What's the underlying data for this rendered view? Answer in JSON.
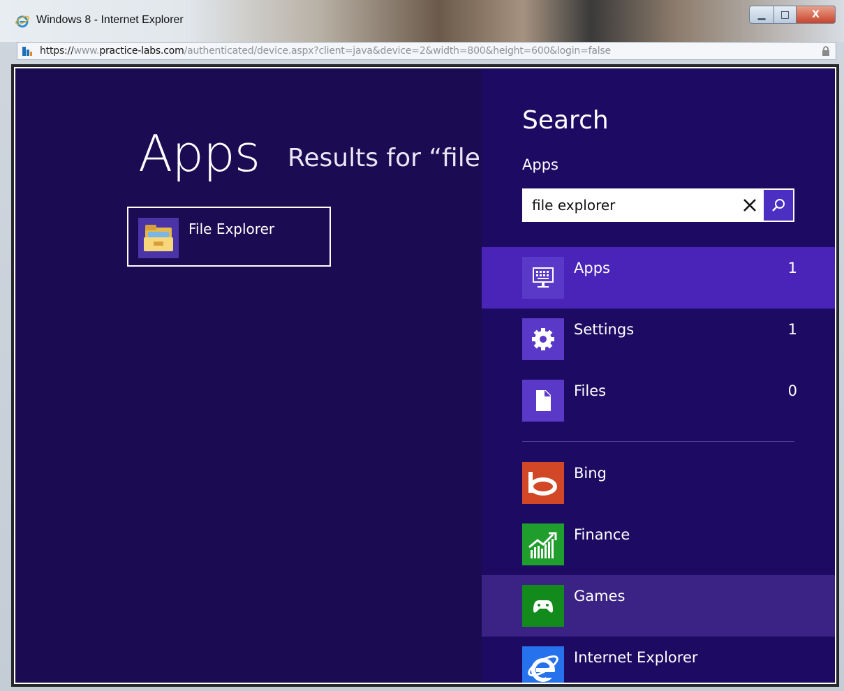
{
  "window": {
    "title": "Windows 8 - Internet Explorer",
    "url_scheme": "https://",
    "url_prefix": "www.",
    "url_host": "practice-labs.com",
    "url_path": "/authenticated/device.aspx?client=java&device=2&width=800&height=600&login=false",
    "controls": {
      "minimize": "▁",
      "maximize": "□",
      "close": "X"
    }
  },
  "start": {
    "heading": "Apps",
    "results_for": "Results for “file e",
    "results": [
      {
        "label": "File Explorer",
        "icon": "folder-icon"
      }
    ]
  },
  "search": {
    "title": "Search",
    "scope": "Apps",
    "query": "file explorer",
    "categories": [
      {
        "label": "Apps",
        "count": "1",
        "icon": "keyboard-monitor-icon",
        "tile_color": "#5a38c8"
      },
      {
        "label": "Settings",
        "count": "1",
        "icon": "gear-icon",
        "tile_color": "#5a38c8"
      },
      {
        "label": "Files",
        "count": "0",
        "icon": "document-icon",
        "tile_color": "#5a38c8"
      }
    ],
    "apps": [
      {
        "label": "Bing",
        "icon": "bing-icon",
        "tile_color": "#d24726"
      },
      {
        "label": "Finance",
        "icon": "finance-chart-icon",
        "tile_color": "#1f9e2e"
      },
      {
        "label": "Games",
        "icon": "gamepad-icon",
        "tile_color": "#128a1c"
      },
      {
        "label": "Internet Explorer",
        "icon": "internet-explorer-icon",
        "tile_color": "#2672ec"
      }
    ]
  },
  "colors": {
    "screen_background": "#1b0b52",
    "search_pane": "#1d0b63",
    "selected_row": "#4a24b8",
    "hovered_row": "#3b2285"
  }
}
